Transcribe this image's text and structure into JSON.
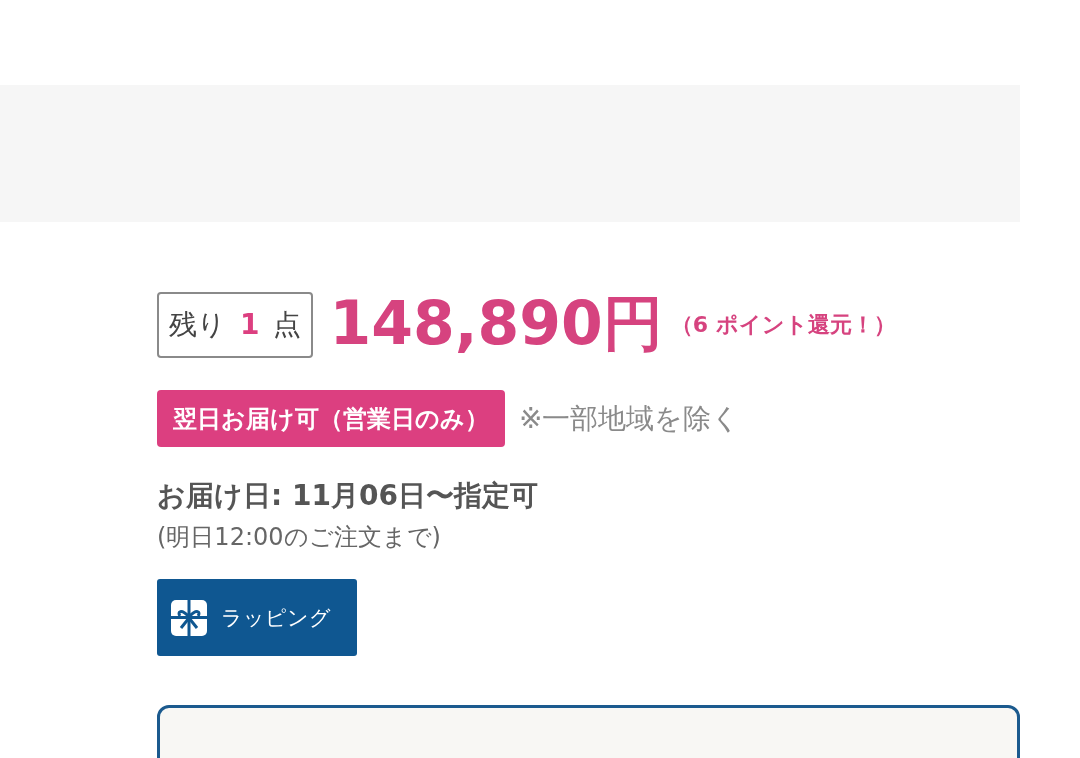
{
  "stock": {
    "label": "残り",
    "count": "1",
    "unit": "点"
  },
  "price": "148,890円",
  "points": "（6 ポイント還元！）",
  "shipping_badge": "翌日お届け可（営業日のみ）",
  "shipping_note": "※一部地域を除く",
  "delivery": {
    "date": "お届け日: 11月06日〜指定可",
    "deadline": "(明日12:00のご注文まで)"
  },
  "wrapping_button": {
    "label": "ラッピング"
  }
}
